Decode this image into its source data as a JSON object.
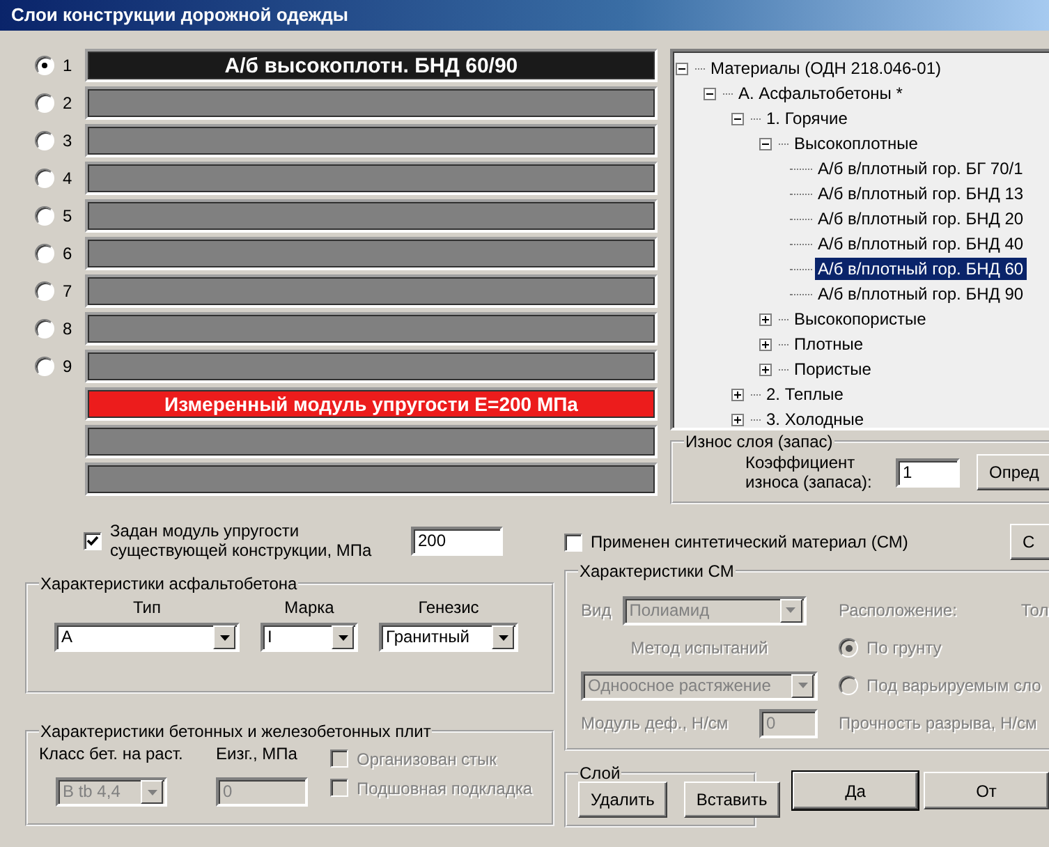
{
  "window": {
    "title": "Слои конструкции дорожной одежды"
  },
  "layers": [
    {
      "number": "1",
      "selected": true,
      "label": "А/б высокоплотн. БНД 60/90"
    },
    {
      "number": "2",
      "selected": false
    },
    {
      "number": "3",
      "selected": false
    },
    {
      "number": "4",
      "selected": false
    },
    {
      "number": "5",
      "selected": false
    },
    {
      "number": "6",
      "selected": false
    },
    {
      "number": "7",
      "selected": false
    },
    {
      "number": "8",
      "selected": false
    },
    {
      "number": "9",
      "selected": false
    }
  ],
  "extra_layers": [
    {
      "kind": "measured",
      "label": "Измеренный модуль упругости Е=200 МПа"
    },
    {
      "kind": "empty"
    },
    {
      "kind": "empty"
    }
  ],
  "tree": {
    "items": [
      {
        "label": "Материалы (ОДН 218.046-01)",
        "expanded": true,
        "selected": false,
        "children": [
          {
            "label": "А.  Асфальтобетоны  *",
            "expanded": true,
            "selected": false,
            "children": [
              {
                "label": "1. Горячие",
                "expanded": true,
                "selected": false,
                "children": [
                  {
                    "label": "Высокоплотные",
                    "expanded": true,
                    "selected": false,
                    "children": [
                      {
                        "label": "А/б в/плотный гор. БГ 70/1",
                        "selected": false
                      },
                      {
                        "label": "А/б в/плотный гор. БНД 13",
                        "selected": false
                      },
                      {
                        "label": "А/б в/плотный гор. БНД 20",
                        "selected": false
                      },
                      {
                        "label": "А/б в/плотный гор. БНД 40",
                        "selected": false
                      },
                      {
                        "label": "А/б в/плотный гор. БНД 60",
                        "selected": true
                      },
                      {
                        "label": "А/б в/плотный гор. БНД 90",
                        "selected": false
                      }
                    ]
                  },
                  {
                    "label": "Высокопористые",
                    "expanded": false,
                    "selected": false
                  },
                  {
                    "label": "Плотные",
                    "expanded": false,
                    "selected": false
                  },
                  {
                    "label": "Пористые",
                    "expanded": false,
                    "selected": false
                  }
                ]
              },
              {
                "label": "2. Теплые",
                "expanded": false,
                "selected": false
              },
              {
                "label": "3. Холодные",
                "expanded": false,
                "selected": false
              }
            ]
          }
        ]
      }
    ]
  },
  "wear_group": {
    "title": "Износ слоя (запас)",
    "label": "Коэффициент износа (запаса):",
    "value": "1",
    "button": "Опред"
  },
  "existing_modulus": {
    "label": "Задан модуль упругости существующей конструкции, МПа",
    "checked": true,
    "value": "200"
  },
  "asphalt_group": {
    "title": "Характеристики асфальтобетона",
    "fields": [
      {
        "label": "Тип",
        "value": "А"
      },
      {
        "label": "Марка",
        "value": "I"
      },
      {
        "label": "Генезис",
        "value": "Гранитный"
      }
    ]
  },
  "concrete_group": {
    "title": "Характеристики бетонных и железобетонных плит",
    "class_label": "Класс бет. на раст.",
    "class": {
      "value": "B tb 4,4",
      "disabled": true
    },
    "e_label": "Еизг., МПа",
    "e": {
      "value": "0",
      "disabled": true
    },
    "options": [
      {
        "label": "Организован стык",
        "checked": false,
        "disabled": true
      },
      {
        "label": "Подшовная подкладка",
        "checked": false,
        "disabled": true
      }
    ]
  },
  "synthetic": {
    "label": "Применен синтетический материал (СМ)",
    "checked": false,
    "button": "С"
  },
  "sm_group": {
    "title": "Характеристики СМ",
    "disabled": true,
    "type_label": "Вид",
    "type": {
      "value": "Полиамид",
      "disabled": true
    },
    "placement_label": "Расположение:",
    "thickness_label": "Тол",
    "method_label": "Метод испытаний",
    "method": {
      "value": "Одноосное растяжение",
      "disabled": true
    },
    "placement_options": [
      {
        "label": "По грунту",
        "selected": true,
        "disabled": true
      },
      {
        "label": "Под варьируемым сло",
        "selected": false,
        "disabled": true
      }
    ],
    "modulus_label": "Модуль деф., Н/см",
    "modulus": {
      "value": "0",
      "disabled": true
    },
    "strength_label": "Прочность разрыва, Н/см"
  },
  "layer_group": {
    "title": "Слой",
    "buttons": [
      "Удалить",
      "Вставить"
    ]
  },
  "dialog_buttons": [
    {
      "label": "Да",
      "default": true
    },
    {
      "label": "От",
      "default": false
    }
  ]
}
